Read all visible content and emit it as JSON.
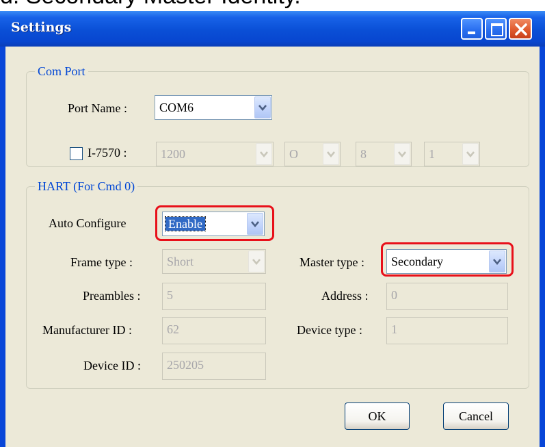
{
  "caption": "d. Secondary Master Identity.",
  "window": {
    "title": "Settings"
  },
  "com_port": {
    "legend": "Com Port",
    "port_name_label": "Port Name :",
    "port_name_value": "COM6",
    "i7570_label": "I-7570 :",
    "i7570_checked": false,
    "baud": "1200",
    "parity": "O",
    "data_bits": "8",
    "stop_bits": "1"
  },
  "hart": {
    "legend": "HART (For Cmd 0)",
    "auto_configure_label": "Auto Configure",
    "auto_configure_value": "Enable",
    "frame_type_label": "Frame type :",
    "frame_type_value": "Short",
    "master_type_label": "Master type :",
    "master_type_value": "Secondary",
    "preambles_label": "Preambles :",
    "preambles_value": "5",
    "address_label": "Address :",
    "address_value": "0",
    "manufacturer_id_label": "Manufacturer ID :",
    "manufacturer_id_value": "62",
    "device_type_label": "Device type :",
    "device_type_value": "1",
    "device_id_label": "Device ID :",
    "device_id_value": "250205"
  },
  "buttons": {
    "ok": "OK",
    "cancel": "Cancel"
  },
  "colors": {
    "titlebar": "#0a4fd6",
    "client": "#ece9d8",
    "legend": "#0046d5",
    "highlight": "#e8101a",
    "selection": "#316ac5"
  },
  "icons": {
    "minimize": "minimize-icon",
    "maximize": "maximize-icon",
    "close": "close-icon",
    "combo": "chevron-down-icon"
  }
}
